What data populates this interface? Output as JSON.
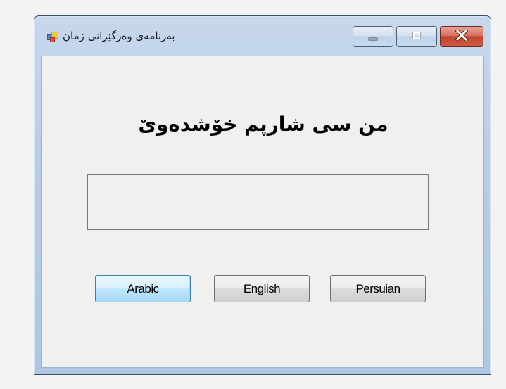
{
  "window": {
    "title": "بەرنامەی وەرگێرانی زمان"
  },
  "main": {
    "heading": "من سی شارپم خۆشدەوێ",
    "output_text": ""
  },
  "buttons": {
    "arabic": "Arabic",
    "english": "English",
    "persian": "Persuian"
  },
  "caption_buttons": {
    "minimize_icon": "minimize-icon",
    "maximize_icon": "maximize-icon",
    "close_icon": "close-icon"
  },
  "colors": {
    "close_button": "#c4432c",
    "focused_button_border": "#3c7fb1",
    "titlebar": "#b8cde6"
  }
}
